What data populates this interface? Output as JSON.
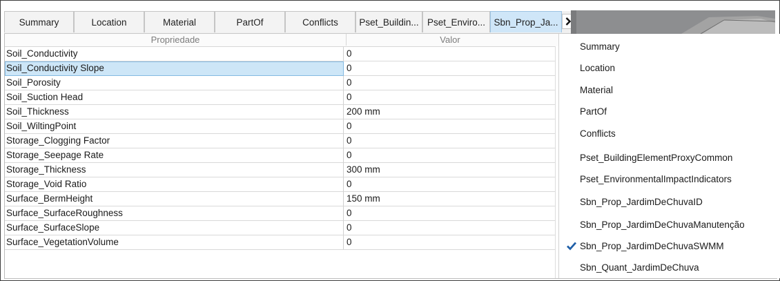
{
  "tabs": [
    {
      "label": "Summary"
    },
    {
      "label": "Location"
    },
    {
      "label": "Material"
    },
    {
      "label": "PartOf"
    },
    {
      "label": "Conflicts"
    },
    {
      "label": "Pset_Buildin..."
    },
    {
      "label": "Pset_Enviro..."
    },
    {
      "label": "Sbn_Prop_Ja...",
      "active": true
    }
  ],
  "grid": {
    "header_property": "Propriedade",
    "header_value": "Valor",
    "rows": [
      {
        "property": "Soil_Conductivity",
        "value": "0"
      },
      {
        "property": "Soil_Conductivity Slope",
        "value": "0",
        "selected": true
      },
      {
        "property": "Soil_Porosity",
        "value": "0"
      },
      {
        "property": "Soil_Suction Head",
        "value": "0"
      },
      {
        "property": "Soil_Thickness",
        "value": "200 mm"
      },
      {
        "property": "Soil_WiltingPoint",
        "value": "0"
      },
      {
        "property": "Storage_Clogging Factor",
        "value": "0"
      },
      {
        "property": "Storage_Seepage Rate",
        "value": "0"
      },
      {
        "property": "Storage_Thickness",
        "value": "300 mm"
      },
      {
        "property": "Storage_Void Ratio",
        "value": "0"
      },
      {
        "property": "Surface_BermHeight",
        "value": "150 mm"
      },
      {
        "property": "Surface_SurfaceRoughness",
        "value": "0"
      },
      {
        "property": "Surface_SurfaceSlope",
        "value": "0"
      },
      {
        "property": "Surface_VegetationVolume",
        "value": "0"
      }
    ]
  },
  "menu": {
    "items": [
      {
        "label": "Summary"
      },
      {
        "label": "Location"
      },
      {
        "label": "Material"
      },
      {
        "label": "PartOf"
      },
      {
        "label": "Conflicts"
      },
      {
        "label": "Pset_BuildingElementProxyCommon"
      },
      {
        "label": "Pset_EnvironmentalImpactIndicators"
      },
      {
        "label": "Sbn_Prop_JardimDeChuvaID"
      },
      {
        "label": "Sbn_Prop_JardimDeChuvaManutenção"
      },
      {
        "label": "Sbn_Prop_JardimDeChuvaSWMM",
        "checked": true
      },
      {
        "label": "Sbn_Quant_JardimDeChuva"
      }
    ]
  },
  "colors": {
    "active_tab": "#cfe6f8",
    "selected_row": "#cde6f7",
    "check_blue": "#1f5fa8"
  }
}
